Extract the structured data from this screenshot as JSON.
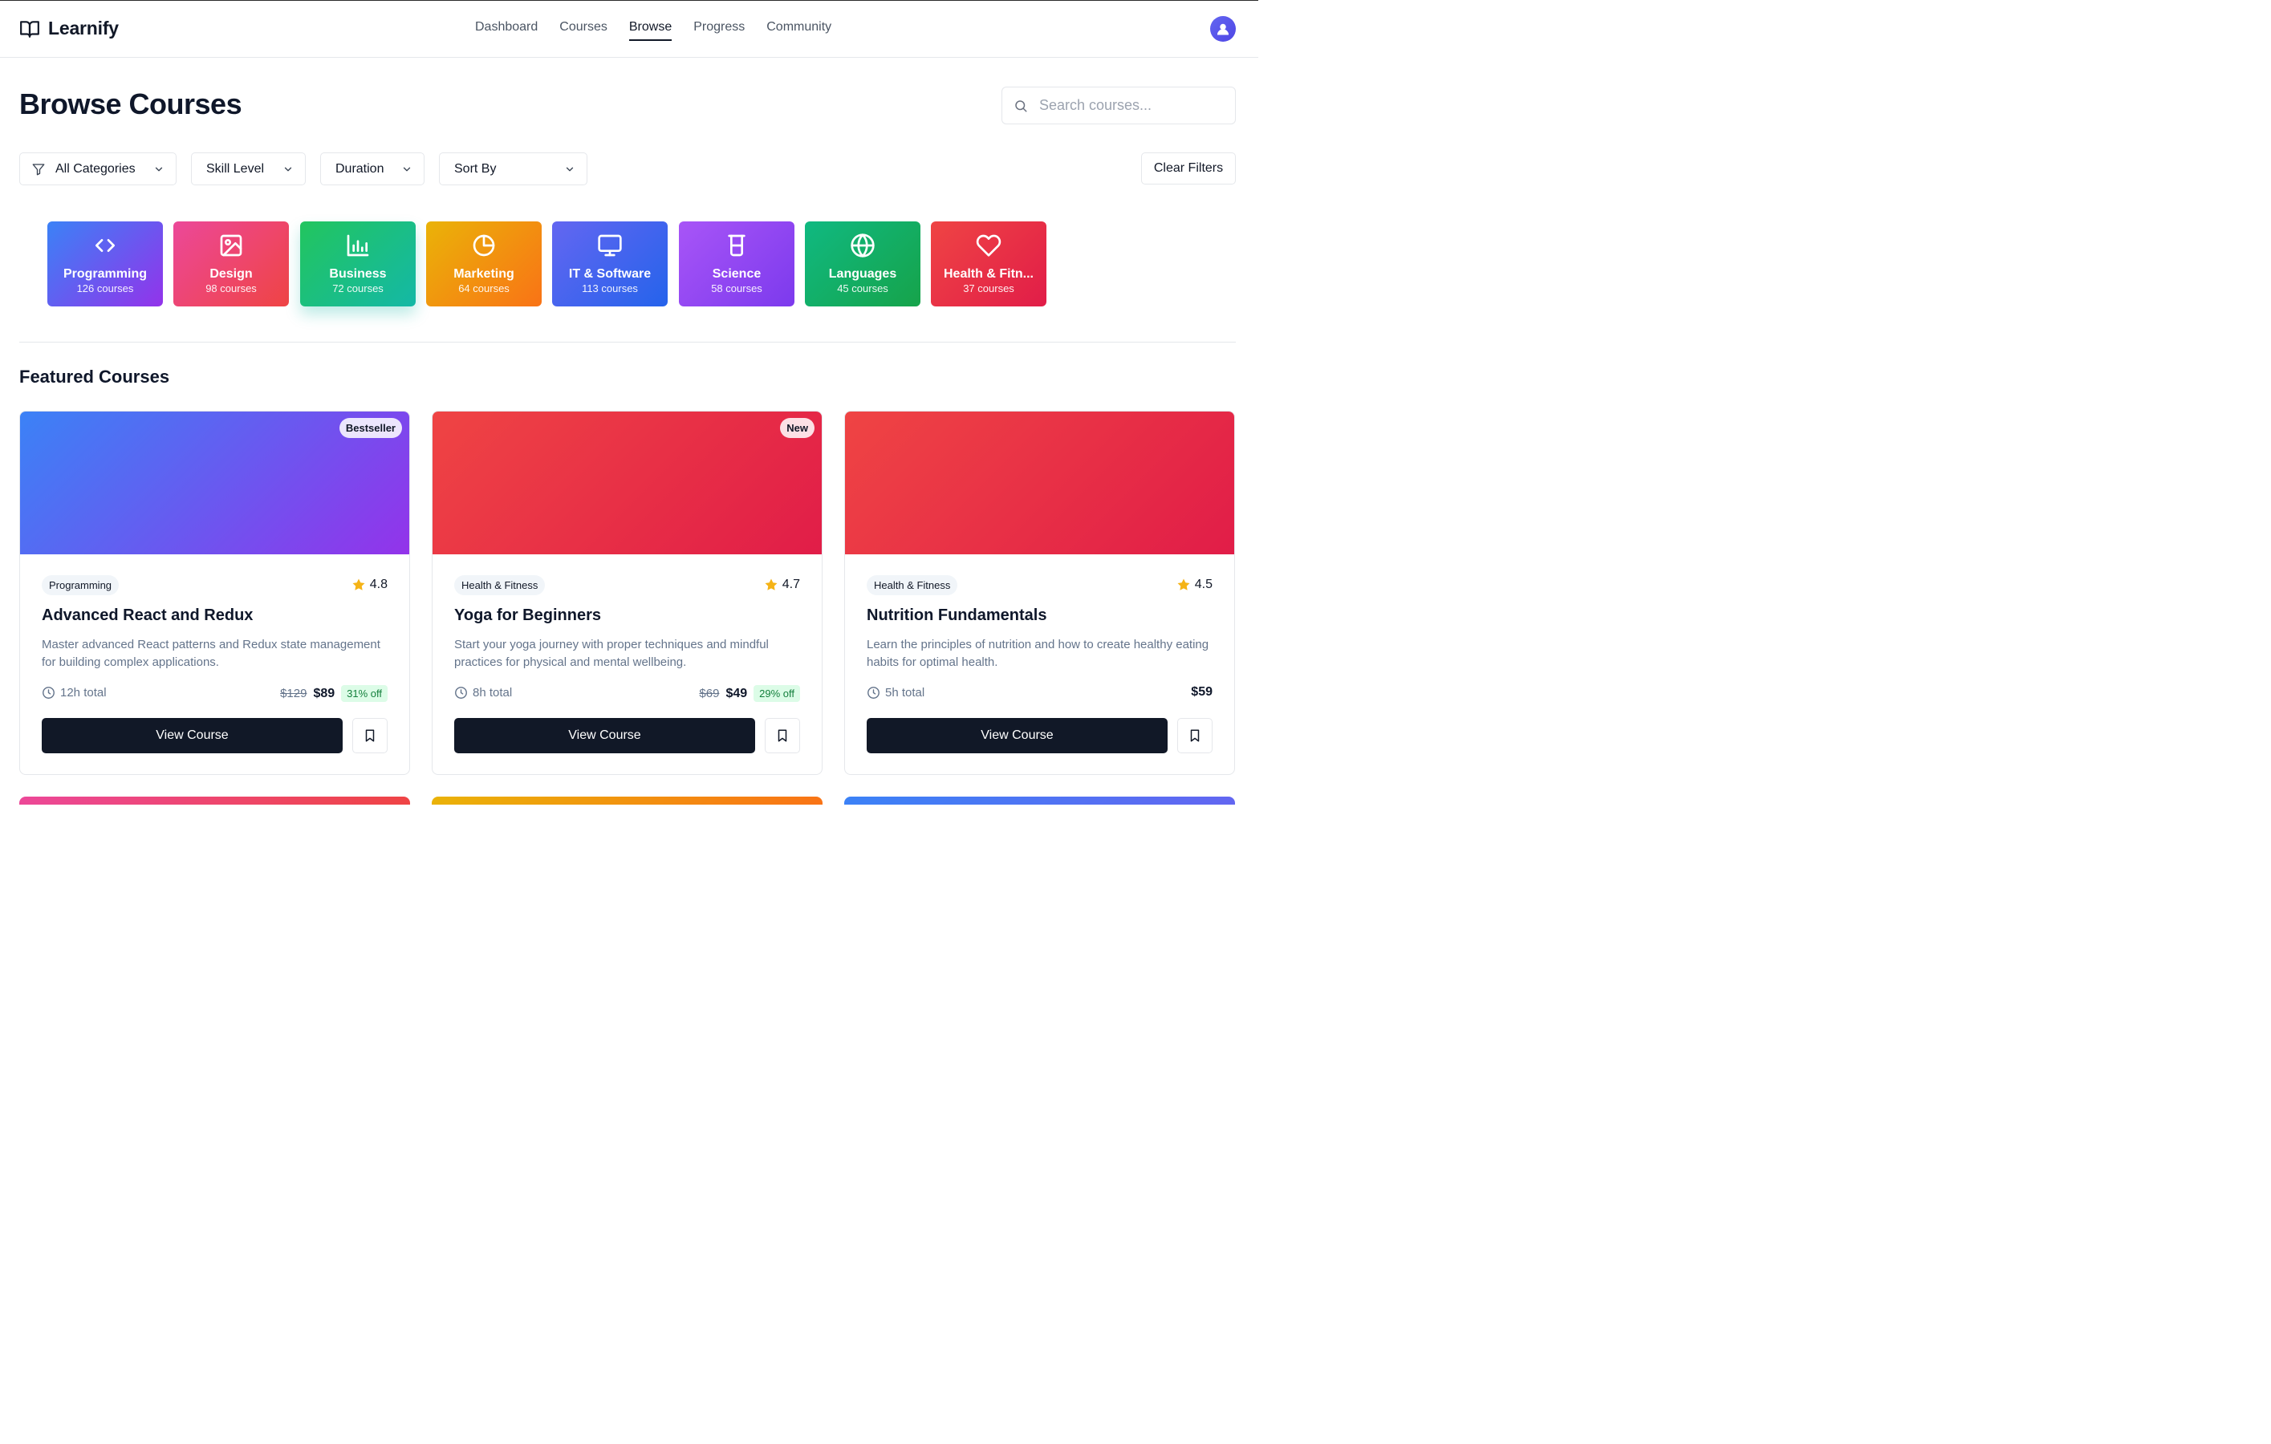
{
  "header": {
    "brand": "Learnify",
    "nav": [
      "Dashboard",
      "Courses",
      "Browse",
      "Progress",
      "Community"
    ],
    "active_nav": "Browse"
  },
  "page": {
    "title": "Browse Courses"
  },
  "search": {
    "placeholder": "Search courses..."
  },
  "filters": {
    "category": "All Categories",
    "skill": "Skill Level",
    "duration": "Duration",
    "sort": "Sort By",
    "clear": "Clear Filters"
  },
  "categories": [
    {
      "name": "Programming",
      "count": "126 courses",
      "icon": "code-icon",
      "colors": [
        "#3b82f6",
        "#9333ea"
      ]
    },
    {
      "name": "Design",
      "count": "98 courses",
      "icon": "image-icon",
      "colors": [
        "#ec4899",
        "#ef4444"
      ]
    },
    {
      "name": "Business",
      "count": "72 courses",
      "icon": "bar-chart-icon",
      "colors": [
        "#22c55e",
        "#14b8a6"
      ]
    },
    {
      "name": "Marketing",
      "count": "64 courses",
      "icon": "pie-chart-icon",
      "colors": [
        "#eab308",
        "#f97316"
      ]
    },
    {
      "name": "IT & Software",
      "count": "113 courses",
      "icon": "monitor-icon",
      "colors": [
        "#6366f1",
        "#2563eb"
      ]
    },
    {
      "name": "Science",
      "count": "58 courses",
      "icon": "beaker-icon",
      "colors": [
        "#a855f7",
        "#7c3aed"
      ]
    },
    {
      "name": "Languages",
      "count": "45 courses",
      "icon": "globe-icon",
      "colors": [
        "#10b981",
        "#16a34a"
      ]
    },
    {
      "name": "Health & Fitn...",
      "count": "37 courses",
      "icon": "heart-icon",
      "colors": [
        "#ef4444",
        "#e11d48"
      ]
    }
  ],
  "featured": {
    "title": "Featured Courses",
    "courses": [
      {
        "badge": "Bestseller",
        "category": "Programming",
        "rating": "4.8",
        "title": "Advanced React and Redux",
        "description": "Master advanced React patterns and Redux state management for building complex applications.",
        "duration": "12h total",
        "old_price": "$129",
        "price": "$89",
        "discount": "31% off",
        "cta": "View Course",
        "colors": [
          "#3b82f6",
          "#9333ea"
        ]
      },
      {
        "badge": "New",
        "category": "Health & Fitness",
        "rating": "4.7",
        "title": "Yoga for Beginners",
        "description": "Start your yoga journey with proper techniques and mindful practices for physical and mental wellbeing.",
        "duration": "8h total",
        "old_price": "$69",
        "price": "$49",
        "discount": "29% off",
        "cta": "View Course",
        "colors": [
          "#ef4444",
          "#e11d48"
        ]
      },
      {
        "badge": "",
        "category": "Health & Fitness",
        "rating": "4.5",
        "title": "Nutrition Fundamentals",
        "description": "Learn the principles of nutrition and how to create healthy eating habits for optimal health.",
        "duration": "5h total",
        "old_price": "",
        "price": "$59",
        "discount": "",
        "cta": "View Course",
        "colors": [
          "#ef4444",
          "#e11d48"
        ]
      }
    ]
  },
  "next_row_colors": [
    [
      "#ec4899",
      "#ef4444"
    ],
    [
      "#eab308",
      "#f97316"
    ],
    [
      "#3b82f6",
      "#6366f1"
    ]
  ],
  "colors": {
    "star": "#f5b316",
    "dark_button": "#111827"
  }
}
